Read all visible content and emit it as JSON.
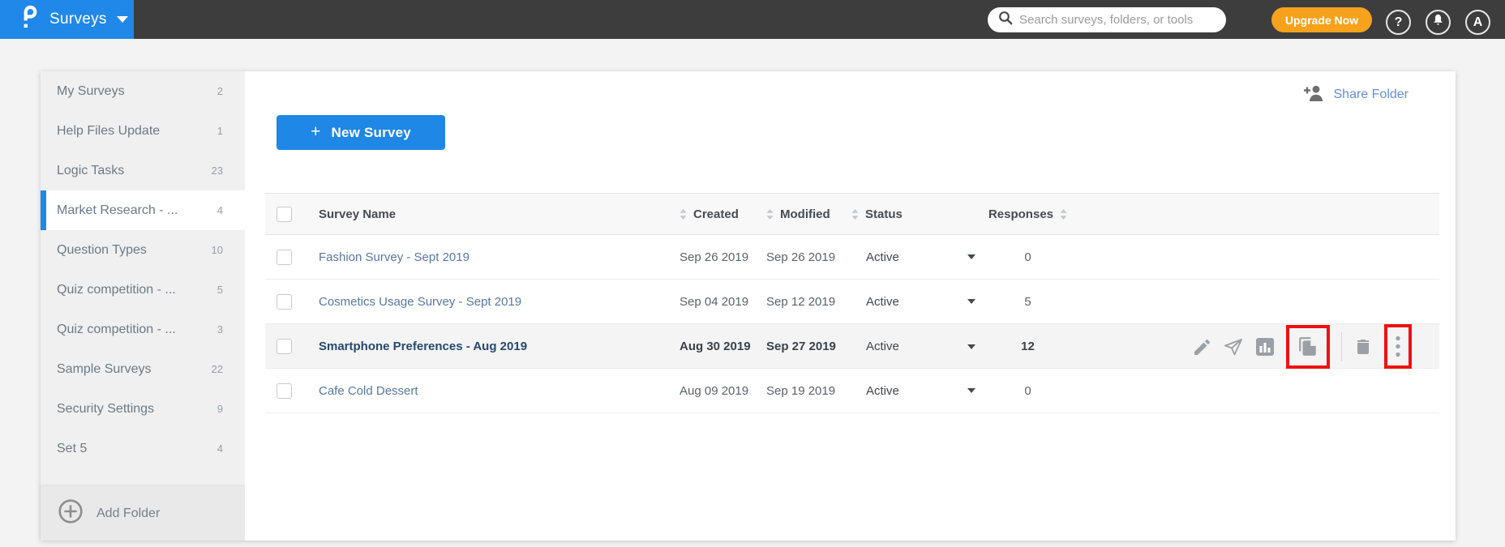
{
  "header": {
    "app_name": "Surveys",
    "search_placeholder": "Search surveys, folders, or tools",
    "upgrade_label": "Upgrade Now",
    "help_glyph": "?",
    "avatar_letter": "A"
  },
  "colors": {
    "brand_blue": "#2088e8",
    "button_blue": "#1f87e5",
    "topbar_dark": "#3d3d3d",
    "upgrade_orange": "#f7a21c",
    "callout_red": "#ee1111",
    "link_blue": "#5878a3",
    "share_link_blue": "#648fd8"
  },
  "icons": {
    "logo": "proprofs-p-logo",
    "search": "magnifier",
    "help": "question-mark-circle",
    "notifications": "bell",
    "account": "avatar-circle",
    "share": "person-plus",
    "add_folder": "plus-circle",
    "sort": "up-down-triangles",
    "status_dropdown": "caret-down",
    "edit": "pencil",
    "send": "paper-plane",
    "reports": "bar-chart",
    "copy": "duplicate-pages",
    "delete": "trash",
    "more": "three-dots-vertical"
  },
  "sidebar": {
    "items": [
      {
        "label": "My Surveys",
        "count": "2",
        "selected": false
      },
      {
        "label": "Help Files Update",
        "count": "1",
        "selected": false
      },
      {
        "label": "Logic Tasks",
        "count": "23",
        "selected": false
      },
      {
        "label": "Market Research - ...",
        "count": "4",
        "selected": true
      },
      {
        "label": "Question Types",
        "count": "10",
        "selected": false
      },
      {
        "label": "Quiz competition - ...",
        "count": "5",
        "selected": false
      },
      {
        "label": "Quiz competition - ...",
        "count": "3",
        "selected": false
      },
      {
        "label": "Sample Surveys",
        "count": "22",
        "selected": false
      },
      {
        "label": "Security Settings",
        "count": "9",
        "selected": false
      },
      {
        "label": "Set 5",
        "count": "4",
        "selected": false
      }
    ],
    "add_folder_label": "Add Folder"
  },
  "main": {
    "share_folder_label": "Share Folder",
    "new_survey_plus": "+",
    "new_survey_label": "New Survey",
    "table": {
      "headers": {
        "name": "Survey Name",
        "created": "Created",
        "modified": "Modified",
        "status": "Status",
        "responses": "Responses"
      },
      "rows": [
        {
          "name": "Fashion Survey - Sept 2019",
          "created": "Sep 26 2019",
          "modified": "Sep 26 2019",
          "status": "Active",
          "responses": "0",
          "highlighted": false
        },
        {
          "name": "Cosmetics Usage Survey - Sept 2019",
          "created": "Sep 04 2019",
          "modified": "Sep 12 2019",
          "status": "Active",
          "responses": "5",
          "highlighted": false
        },
        {
          "name": "Smartphone Preferences - Aug 2019",
          "created": "Aug 30 2019",
          "modified": "Sep 27 2019",
          "status": "Active",
          "responses": "12",
          "highlighted": true,
          "callouts": [
            "copy",
            "more"
          ]
        },
        {
          "name": "Cafe Cold Dessert",
          "created": "Aug 09 2019",
          "modified": "Sep 19 2019",
          "status": "Active",
          "responses": "0",
          "highlighted": false
        }
      ]
    }
  }
}
